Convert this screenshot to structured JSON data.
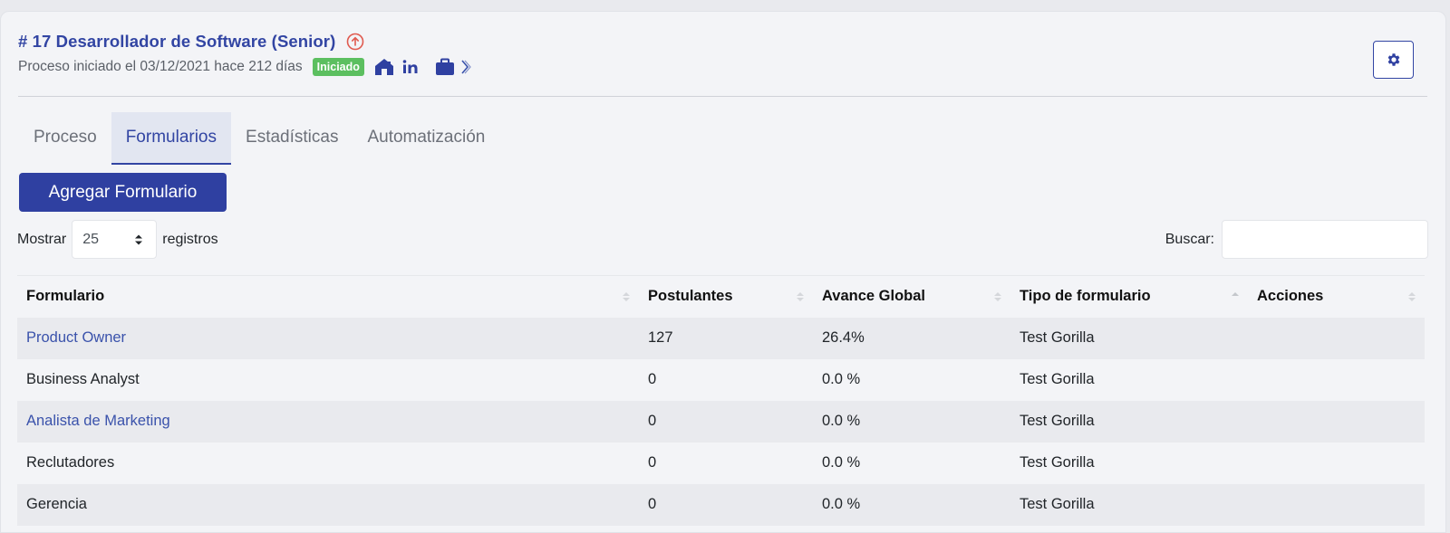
{
  "header": {
    "title": "# 17 Desarrollador de Software (Senior)",
    "subtitle": "Proceso iniciado el 03/12/2021 hace 212 días",
    "status_badge": "Iniciado",
    "icons": [
      "arrow-up-circle-icon",
      "house-icon",
      "linkedin-icon",
      "briefcase-icon",
      "chevron-right-icon"
    ],
    "settings_icon": "gear-icon"
  },
  "tabs": [
    {
      "label": "Proceso",
      "active": false
    },
    {
      "label": "Formularios",
      "active": true
    },
    {
      "label": "Estadísticas",
      "active": false
    },
    {
      "label": "Automatización",
      "active": false
    }
  ],
  "toolbar": {
    "add_label": "Agregar Formulario",
    "show_label": "Mostrar",
    "page_size": "25",
    "records_label": "registros",
    "search_label": "Buscar:",
    "search_value": ""
  },
  "table": {
    "columns": [
      "Formulario",
      "Postulantes",
      "Avance Global",
      "Tipo de formulario",
      "Acciones"
    ],
    "rows": [
      {
        "formulario": "Product Owner",
        "postulantes": "127",
        "avance": "26.4%",
        "tipo": "Test Gorilla",
        "acciones": "",
        "link": true
      },
      {
        "formulario": "Business Analyst",
        "postulantes": "0",
        "avance": "0.0 %",
        "tipo": "Test Gorilla",
        "acciones": "",
        "link": false
      },
      {
        "formulario": "Analista de Marketing",
        "postulantes": "0",
        "avance": "0.0 %",
        "tipo": "Test Gorilla",
        "acciones": "",
        "link": true
      },
      {
        "formulario": "Reclutadores",
        "postulantes": "0",
        "avance": "0.0 %",
        "tipo": "Test Gorilla",
        "acciones": "",
        "link": false
      },
      {
        "formulario": "Gerencia",
        "postulantes": "0",
        "avance": "0.0 %",
        "tipo": "Test Gorilla",
        "acciones": "",
        "link": false
      }
    ]
  },
  "colors": {
    "brand": "#3245a3",
    "badge_green": "#5cbf60",
    "link": "#3a52ab",
    "alert_red": "#e05a4f"
  }
}
